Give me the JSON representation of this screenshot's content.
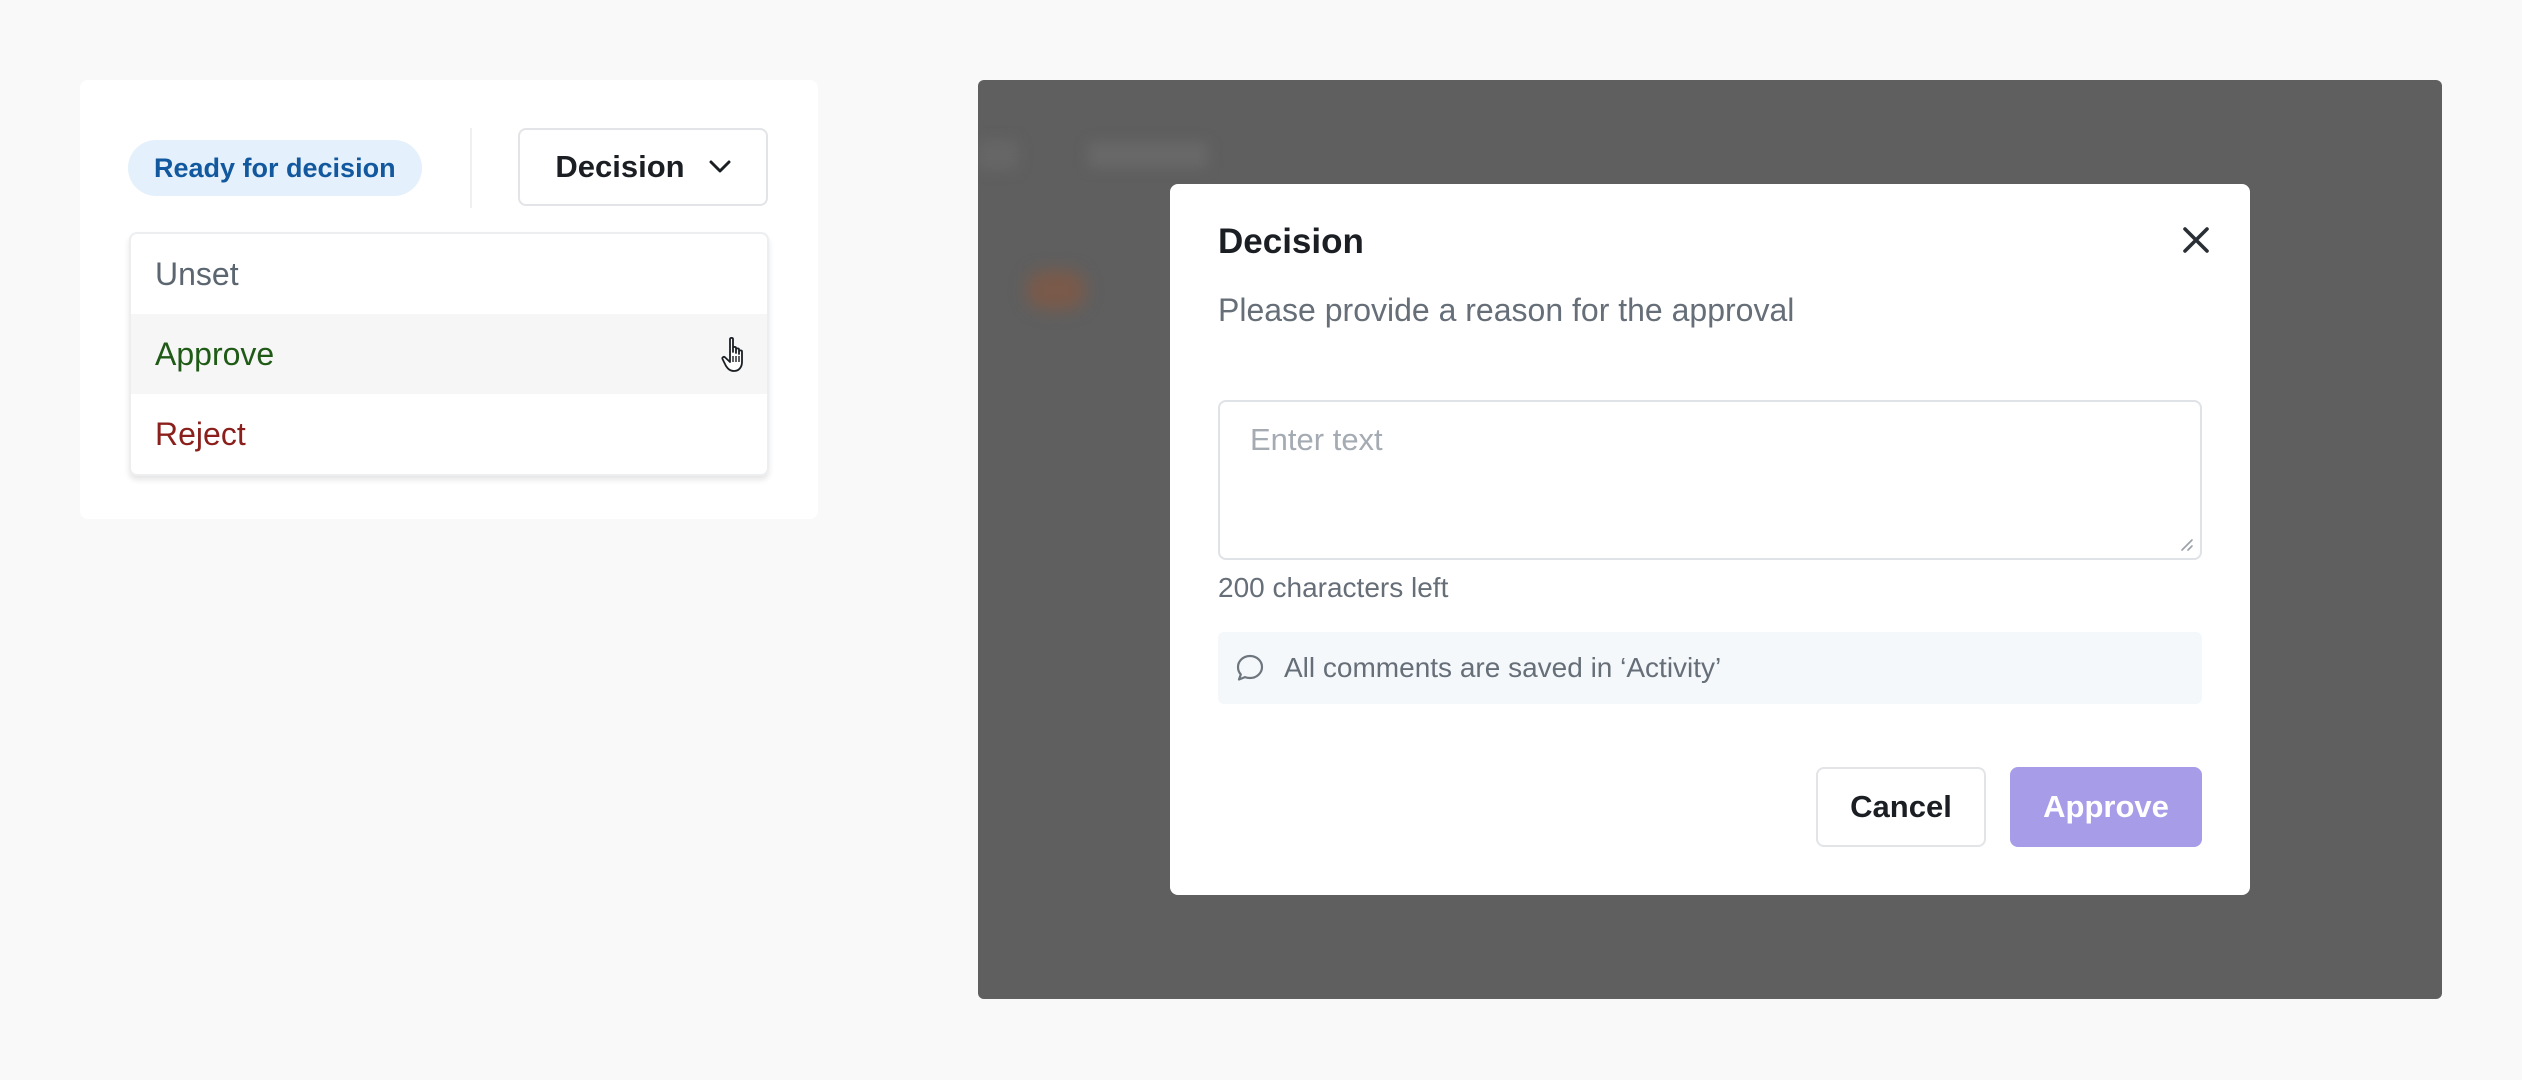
{
  "left_panel": {
    "status_badge": "Ready for decision",
    "decision_dropdown": {
      "label": "Decision",
      "icon": "chevron-down-icon",
      "options": [
        {
          "label": "Unset",
          "color": "#5c6670"
        },
        {
          "label": "Approve",
          "color": "#1f5a16"
        },
        {
          "label": "Reject",
          "color": "#8a1f1b"
        }
      ],
      "hovered_option": "Approve"
    }
  },
  "modal": {
    "title": "Decision",
    "close_icon": "close-icon",
    "subtitle": "Please provide a reason for the approval",
    "textarea": {
      "placeholder": "Enter text",
      "value": ""
    },
    "char_count": "200 characters left",
    "info": {
      "icon": "comment-icon",
      "text": "All comments are saved in ‘Activity’"
    },
    "cancel_label": "Cancel",
    "approve_label": "Approve"
  },
  "colors": {
    "badge_bg": "#e4f0fb",
    "badge_text": "#12589e",
    "overlay": "#5f5f5f",
    "approve_button": "#a79ce8",
    "info_bg": "#f4f8fb"
  }
}
